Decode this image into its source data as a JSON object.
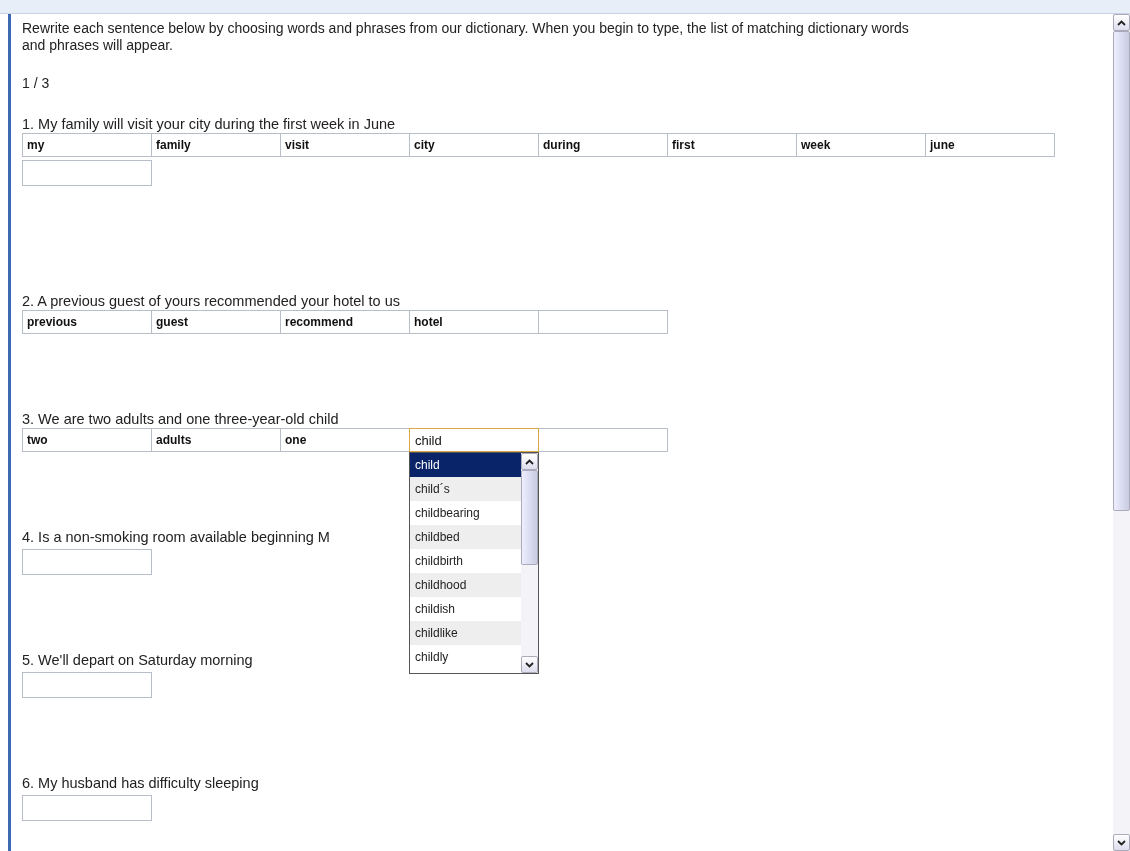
{
  "instructions": "Rewrite each sentence below by choosing words and phrases from our dictionary. When you begin to type, the list of matching dictionary words and phrases will appear.",
  "progress": "1 / 3",
  "questions": [
    {
      "text": "1. My family will visit your city during the first week in June",
      "words": [
        {
          "kind": "word",
          "text": "my"
        },
        {
          "kind": "word",
          "text": "family"
        },
        {
          "kind": "word",
          "text": "visit"
        },
        {
          "kind": "word",
          "text": "city"
        },
        {
          "kind": "word",
          "text": "during"
        },
        {
          "kind": "word",
          "text": "first"
        },
        {
          "kind": "word",
          "text": "week"
        },
        {
          "kind": "word",
          "text": "june"
        }
      ],
      "answer_field": true
    },
    {
      "text": "2. A previous guest of yours recommended your hotel to us",
      "words": [
        {
          "kind": "word",
          "text": "previous"
        },
        {
          "kind": "word",
          "text": "guest"
        },
        {
          "kind": "word",
          "text": "recommend"
        },
        {
          "kind": "word",
          "text": "hotel"
        },
        {
          "kind": "input",
          "focused": false
        }
      ],
      "answer_field": false
    },
    {
      "text": "3. We are two adults and one three-year-old child",
      "words": [
        {
          "kind": "word",
          "text": "two"
        },
        {
          "kind": "word",
          "text": "adults"
        },
        {
          "kind": "word",
          "text": "one"
        },
        {
          "kind": "input",
          "value": "child",
          "focused": true,
          "suggestions": [
            {
              "text": "child",
              "selected": true
            },
            {
              "text": "child´s",
              "selected": false
            },
            {
              "text": "childbearing",
              "selected": false
            },
            {
              "text": "childbed",
              "selected": false
            },
            {
              "text": "childbirth",
              "selected": false
            },
            {
              "text": "childhood",
              "selected": false
            },
            {
              "text": "childish",
              "selected": false
            },
            {
              "text": "childlike",
              "selected": false
            },
            {
              "text": "childly",
              "selected": false
            }
          ]
        },
        {
          "kind": "input",
          "focused": false
        }
      ],
      "answer_field": false
    },
    {
      "text": "4. Is a non-smoking room available beginning M",
      "answer_field": true
    },
    {
      "text": "5. We'll depart on Saturday morning",
      "answer_field": true
    },
    {
      "text": "6. My husband has difficulty sleeping",
      "answer_field": true
    }
  ]
}
